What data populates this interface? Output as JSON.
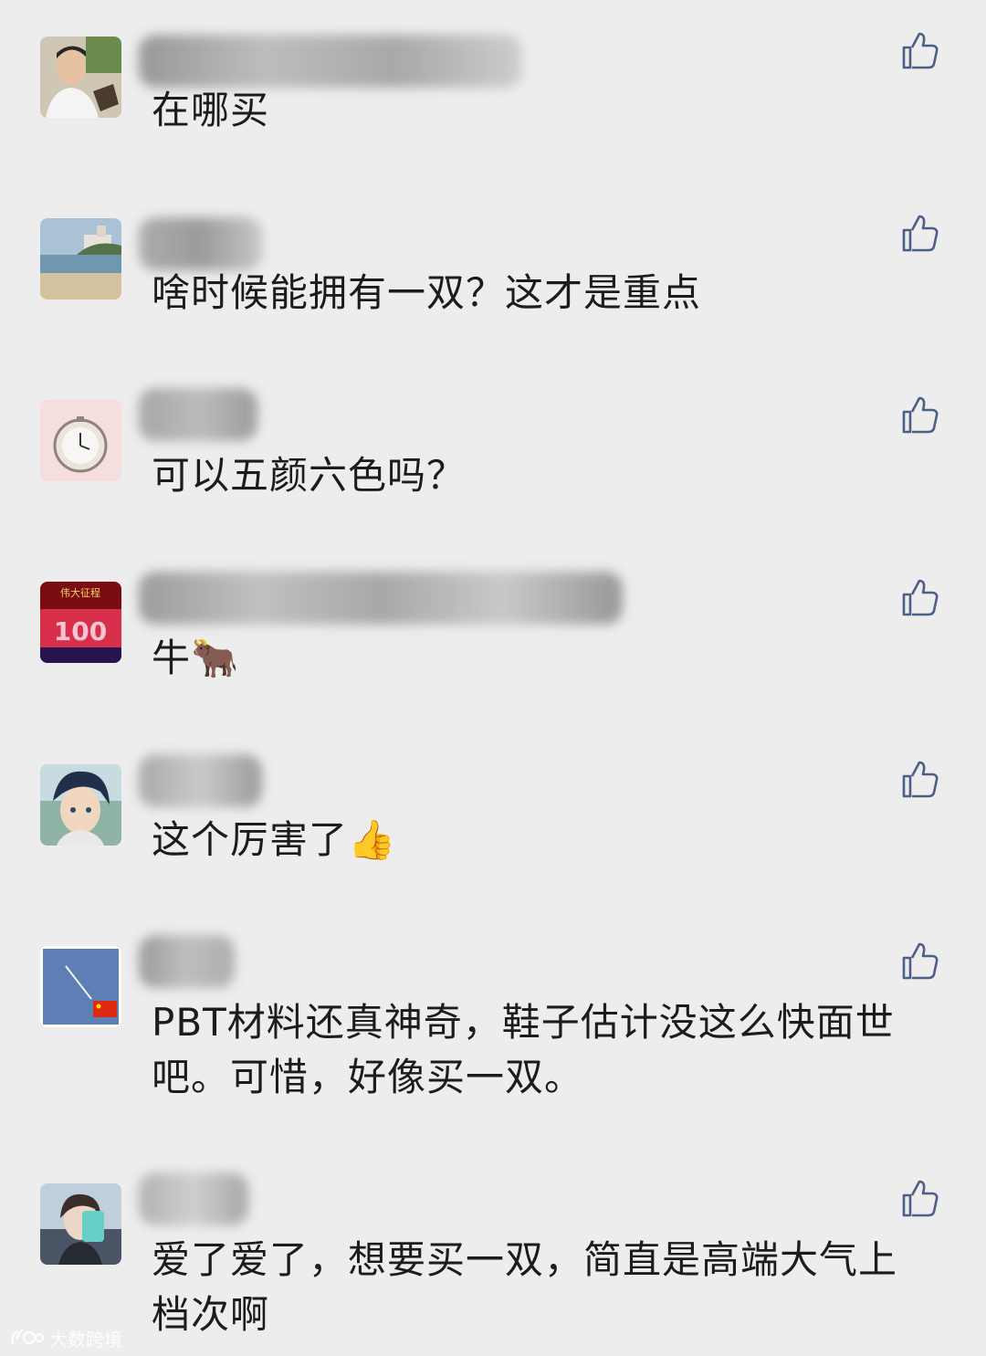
{
  "comments": [
    {
      "text": "在哪买"
    },
    {
      "text": "啥时候能拥有一双？这才是重点"
    },
    {
      "text": "可以五颜六色吗？"
    },
    {
      "text": "牛🐂"
    },
    {
      "text": "这个厉害了👍"
    },
    {
      "text": "PBT材料还真神奇，鞋子估计没这么快面世吧。可惜，好像买一双。"
    },
    {
      "text": "爱了爱了，想要买一双，简直是高端大气上档次啊"
    }
  ],
  "avatar4_text": {
    "banner": "伟大征程",
    "number": "100"
  },
  "watermark": {
    "label": "大数跨境"
  },
  "colors": {
    "background": "#ededed",
    "text": "#1c1c1c",
    "like_icon": "#4d5f86"
  }
}
